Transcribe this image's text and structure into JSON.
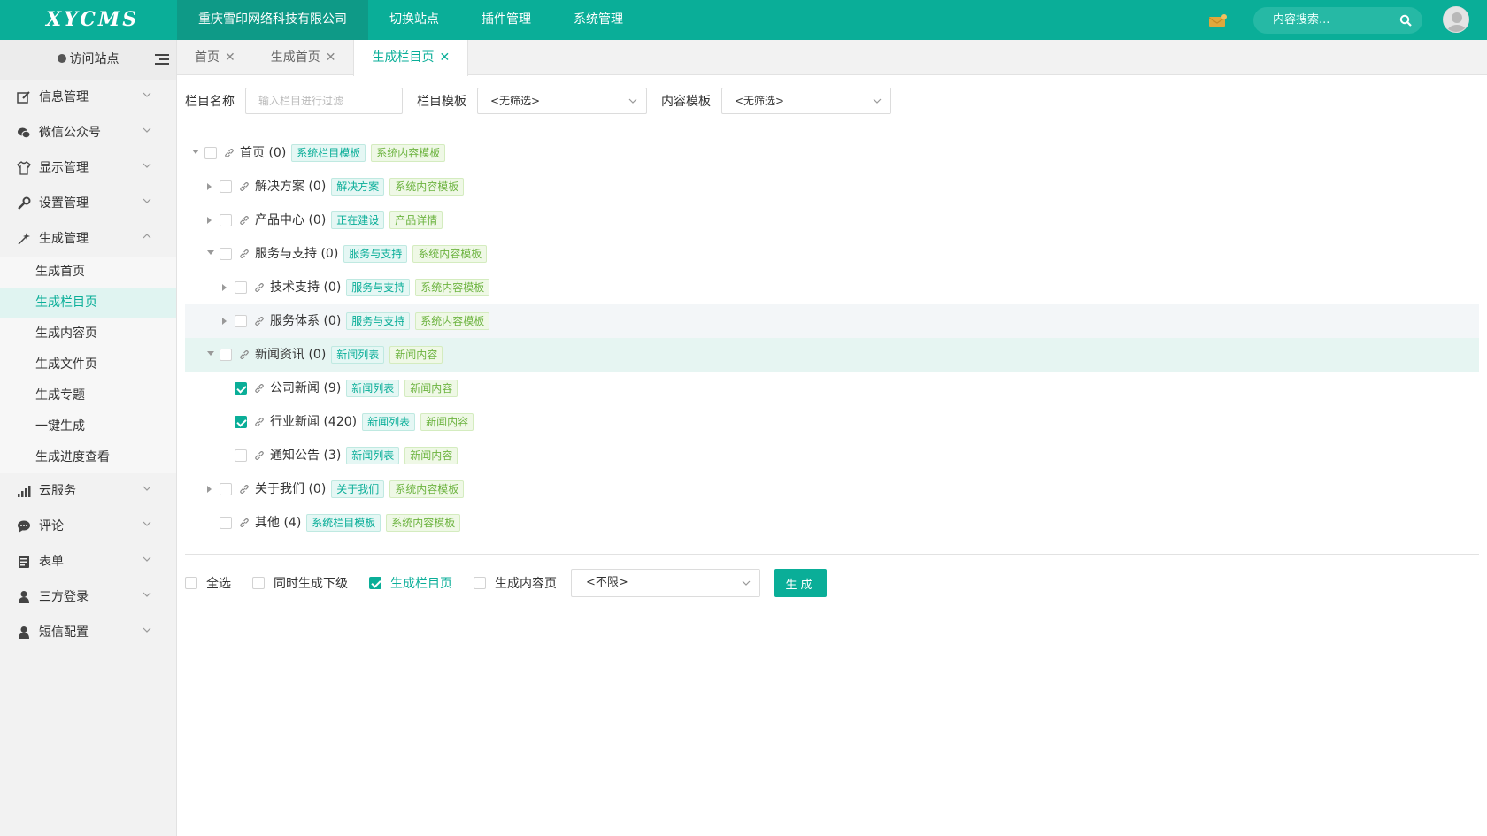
{
  "app": {
    "logo": "XYCMS",
    "site_name": "重庆雪印网络科技有限公司"
  },
  "topnav": [
    {
      "label": "重庆雪印网络科技有限公司",
      "active": true
    },
    {
      "label": "切换站点"
    },
    {
      "label": "插件管理"
    },
    {
      "label": "系统管理"
    }
  ],
  "search": {
    "placeholder": "内容搜索..."
  },
  "colors": {
    "accent": "#0aae98",
    "mail": "#e0a83c",
    "tag_green": "#6cb33f"
  },
  "sidebar": {
    "visit": "访问站点",
    "items": [
      {
        "label": "信息管理",
        "icon": "edit-icon"
      },
      {
        "label": "微信公众号",
        "icon": "wechat-icon"
      },
      {
        "label": "显示管理",
        "icon": "shirt-icon"
      },
      {
        "label": "设置管理",
        "icon": "wrench-icon"
      },
      {
        "label": "生成管理",
        "icon": "magic-wand-icon",
        "expanded": true
      },
      {
        "label": "云服务",
        "icon": "signal-icon"
      },
      {
        "label": "评论",
        "icon": "comment-icon"
      },
      {
        "label": "表单",
        "icon": "form-icon"
      },
      {
        "label": "三方登录",
        "icon": "user-icon"
      },
      {
        "label": "短信配置",
        "icon": "user-icon"
      }
    ],
    "sub_items": [
      "生成首页",
      "生成栏目页",
      "生成内容页",
      "生成文件页",
      "生成专题",
      "一键生成",
      "生成进度查看"
    ],
    "active_sub": "生成栏目页"
  },
  "tabs": [
    {
      "label": "首页"
    },
    {
      "label": "生成首页"
    },
    {
      "label": "生成栏目页",
      "active": true
    }
  ],
  "filter": {
    "name_label": "栏目名称",
    "name_placeholder": "输入栏目进行过滤",
    "tpl_label": "栏目模板",
    "tpl_value": "<无筛选>",
    "content_label": "内容模板",
    "content_value": "<无筛选>"
  },
  "tree": [
    {
      "label": "首页 (0)",
      "tags": [
        "系统栏目模板",
        "系统内容模板"
      ],
      "level": 0,
      "caret": "down",
      "checked": false
    },
    {
      "label": "解决方案 (0)",
      "tags": [
        "解决方案",
        "系统内容模板"
      ],
      "level": 1,
      "caret": "right",
      "checked": false
    },
    {
      "label": "产品中心 (0)",
      "tags": [
        "正在建设",
        "产品详情"
      ],
      "level": 1,
      "caret": "right",
      "checked": false
    },
    {
      "label": "服务与支持 (0)",
      "tags": [
        "服务与支持",
        "系统内容模板"
      ],
      "level": 1,
      "caret": "down",
      "checked": false
    },
    {
      "label": "技术支持 (0)",
      "tags": [
        "服务与支持",
        "系统内容模板"
      ],
      "level": 2,
      "caret": "right",
      "checked": false
    },
    {
      "label": "服务体系 (0)",
      "tags": [
        "服务与支持",
        "系统内容模板"
      ],
      "level": 2,
      "caret": "right",
      "checked": false,
      "state": "hover"
    },
    {
      "label": "新闻资讯 (0)",
      "tags": [
        "新闻列表",
        "新闻内容"
      ],
      "level": 1,
      "caret": "down",
      "checked": false,
      "state": "active"
    },
    {
      "label": "公司新闻 (9)",
      "tags": [
        "新闻列表",
        "新闻内容"
      ],
      "level": 2,
      "caret": "",
      "checked": true
    },
    {
      "label": "行业新闻 (420)",
      "tags": [
        "新闻列表",
        "新闻内容"
      ],
      "level": 2,
      "caret": "",
      "checked": true
    },
    {
      "label": "通知公告 (3)",
      "tags": [
        "新闻列表",
        "新闻内容"
      ],
      "level": 2,
      "caret": "",
      "checked": false
    },
    {
      "label": "关于我们 (0)",
      "tags": [
        "关于我们",
        "系统内容模板"
      ],
      "level": 1,
      "caret": "right",
      "checked": false
    },
    {
      "label": "其他 (4)",
      "tags": [
        "系统栏目模板",
        "系统内容模板"
      ],
      "level": 1,
      "caret": "",
      "checked": false
    }
  ],
  "bottom": {
    "select_all": "全选",
    "gen_children": "同时生成下级",
    "gen_column": "生成栏目页",
    "gen_content": "生成内容页",
    "limit": "<不限>",
    "generate": "生成"
  }
}
